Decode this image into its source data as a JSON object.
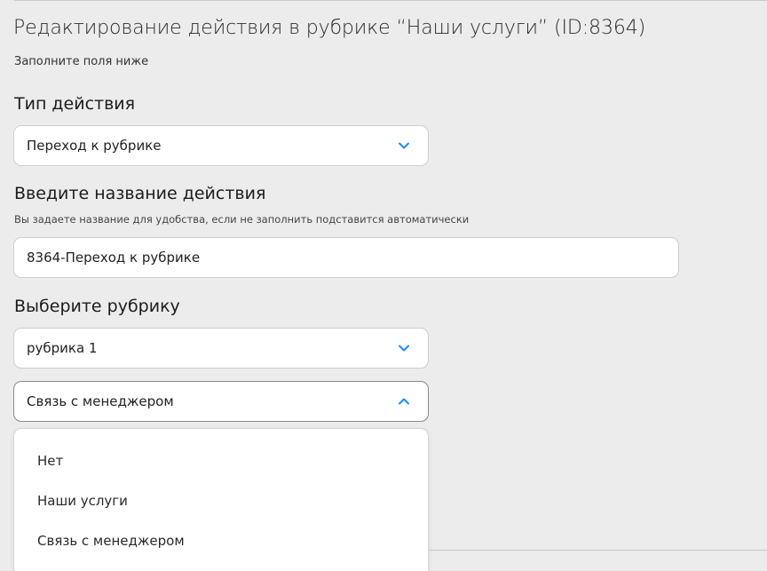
{
  "header": {
    "title": "Редактирование действия в рубрике “Наши услуги” (ID:8364)",
    "subtitle": "Заполните поля ниже"
  },
  "action_type": {
    "label": "Тип действия",
    "selected": "Переход к рубрике",
    "icon": "chevron-down-icon"
  },
  "action_name": {
    "label": "Введите название действия",
    "hint": "Вы задаете название для удобства, если не заполнить подставится автоматически",
    "value": "8364-Переход к рубрике"
  },
  "rubric": {
    "label": "Выберите рубрику",
    "selected": "рубрика 1",
    "icon": "chevron-down-icon"
  },
  "sub_rubric": {
    "selected": "Связь с менеджером",
    "icon": "chevron-up-icon",
    "options": [
      "Нет",
      "Наши услуги",
      "Связь с менеджером"
    ]
  },
  "colors": {
    "accent": "#1a8cff",
    "background": "#ececec",
    "field": "#ffffff"
  }
}
